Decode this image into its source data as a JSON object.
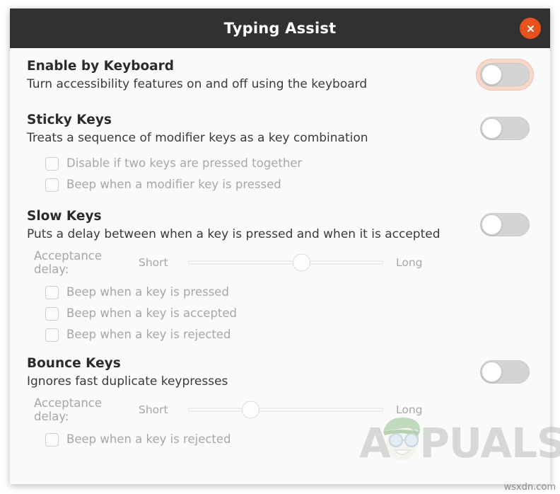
{
  "window": {
    "title": "Typing Assist",
    "close_icon": "close-icon",
    "accent_color": "#e8501c",
    "titlebar_color": "#333130",
    "body_color": "#fafafa"
  },
  "sections": [
    {
      "title": "Enable by Keyboard",
      "description": "Turn accessibility features on and off using the keyboard",
      "toggle": {
        "state": "off",
        "focused": true
      }
    },
    {
      "title": "Sticky Keys",
      "description": "Treats a sequence of modifier keys as a key combination",
      "toggle": {
        "state": "off",
        "focused": false
      },
      "checkboxes": [
        {
          "label": "Disable if two keys are pressed together",
          "checked": false
        },
        {
          "label": "Beep when a modifier key is pressed",
          "checked": false
        }
      ]
    },
    {
      "title": "Slow Keys",
      "description": "Puts a delay between when a key is pressed and when it is accepted",
      "toggle": {
        "state": "off",
        "focused": false
      },
      "slider": {
        "caption": "Acceptance delay:",
        "min_label": "Short",
        "max_label": "Long",
        "value_percent": 58
      },
      "checkboxes": [
        {
          "label": "Beep when a key is pressed",
          "checked": false
        },
        {
          "label": "Beep when a key is accepted",
          "checked": false
        },
        {
          "label": "Beep when a key is rejected",
          "checked": false
        }
      ]
    },
    {
      "title": "Bounce Keys",
      "description": "Ignores fast duplicate keypresses",
      "toggle": {
        "state": "off",
        "focused": false
      },
      "slider": {
        "caption": "Acceptance delay:",
        "min_label": "Short",
        "max_label": "Long",
        "value_percent": 32
      },
      "checkboxes": [
        {
          "label": "Beep when a key is rejected",
          "checked": false
        }
      ]
    }
  ],
  "watermark": {
    "text": "APPUALS"
  },
  "site_credit": "wsxdn.com"
}
